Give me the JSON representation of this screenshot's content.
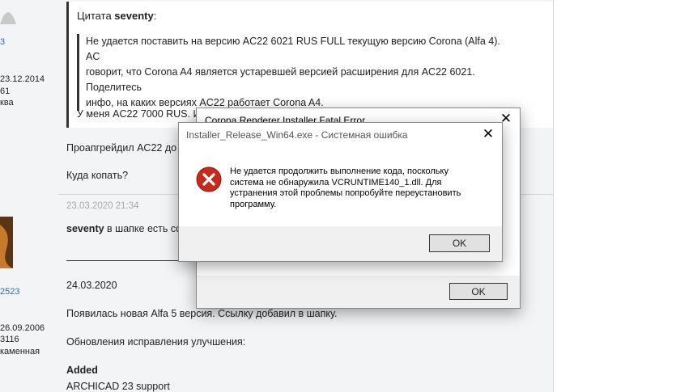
{
  "left_profiles": {
    "user1": {
      "number": "3",
      "date": "23.12.2014",
      "count": "61",
      "location": "ква"
    },
    "user2": {
      "number": "2523",
      "date": "26.09.2006",
      "count": "3116",
      "location": "каменная"
    }
  },
  "post1": {
    "quote_label": "Цитата",
    "quote_author": "seventy",
    "quote_suffix": ":",
    "quote_lines": [
      "Не удается поставить на версию AC22 6021 RUS FULL текущую версию Corona (Alfa 4). AC",
      "говорит, что Corona A4 является устаревшей версией расширения для AC22 6021. Поделитесь",
      "инфо, на каких версиях AC22 работает Corona A4."
    ],
    "quote_tail": "У меня AC22 7000 RUS. И",
    "line1": "Проапгрейдил AC22 до 7",
    "line2": "Куда копать?"
  },
  "post2": {
    "date": "23.03.2020 21:34",
    "author": "seventy",
    "text": "в шапке есть ссь",
    "date2": "24.03.2020",
    "line1": "Появилась новая Alfa 5 версия. Ссылку добавил в шапку.",
    "line2": "Обновления исправления улучшения:",
    "added_heading": "Added",
    "added_item": "ARCHICAD 23 support"
  },
  "back_dialog": {
    "title": "Corona Renderer Installer Fatal Error",
    "close": "✕",
    "ok_label": "OK"
  },
  "front_dialog": {
    "title": "Installer_Release_Win64.exe - Системная ошибка",
    "close": "✕",
    "message": "Не удается продолжить выполнение кода, поскольку система не обнаружила VCRUNTIME140_1.dll. Для устранения этой проблемы попробуйте переустановить программу.",
    "ok_label": "OK",
    "icon": "error-icon"
  },
  "colors": {
    "error_red": "#c42b1c",
    "link_blue": "#2a6db5"
  }
}
